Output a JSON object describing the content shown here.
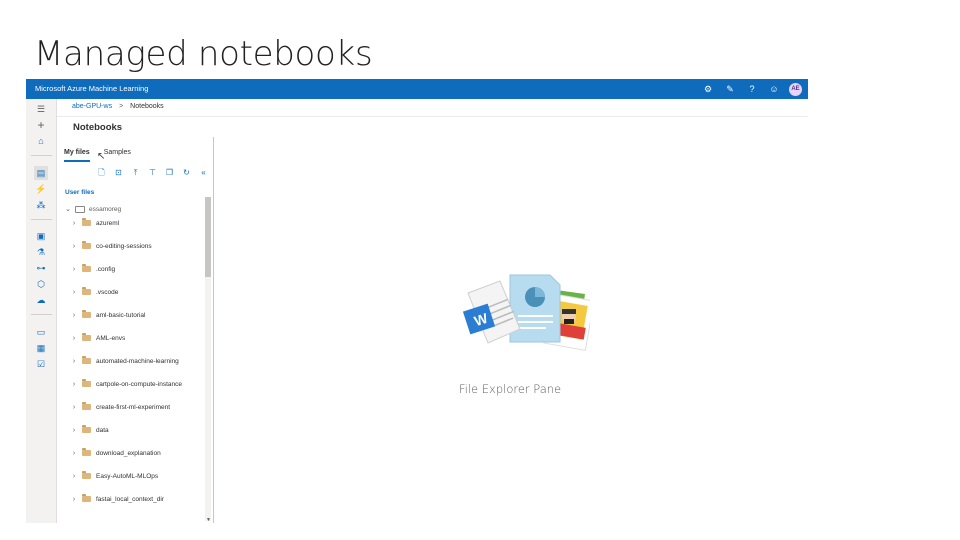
{
  "slide": {
    "title": "Managed notebooks"
  },
  "app": {
    "title": "Microsoft Azure Machine Learning"
  },
  "topbar_icons": [
    "settings-icon",
    "feedback-icon",
    "help-icon",
    "smiley-icon"
  ],
  "user": {
    "initials": "AE"
  },
  "breadcrumb": {
    "workspace": "abe-GPU-ws",
    "separator": ">",
    "current": "Notebooks"
  },
  "page": {
    "title": "Notebooks"
  },
  "file_pane": {
    "tabs": [
      {
        "label": "My files",
        "active": true
      },
      {
        "label": "Samples",
        "active": false
      }
    ],
    "section_label": "User files",
    "root_folder": "essamoreg",
    "folders": [
      "azureml",
      "co-editing-sessions",
      ".config",
      ".vscode",
      "aml-basic-tutorial",
      "AML-envs",
      "automated-machine-learning",
      "cartpole-on-compute-instance",
      "create-first-ml-experiment",
      "data",
      "download_explanation",
      "Easy-AutoML-MLOps",
      "fastai_local_context_dir"
    ]
  },
  "empty_state": {
    "label": "File Explorer Pane"
  },
  "colors": {
    "accent": "#0f6cbd",
    "folder": "#dcb67a"
  }
}
